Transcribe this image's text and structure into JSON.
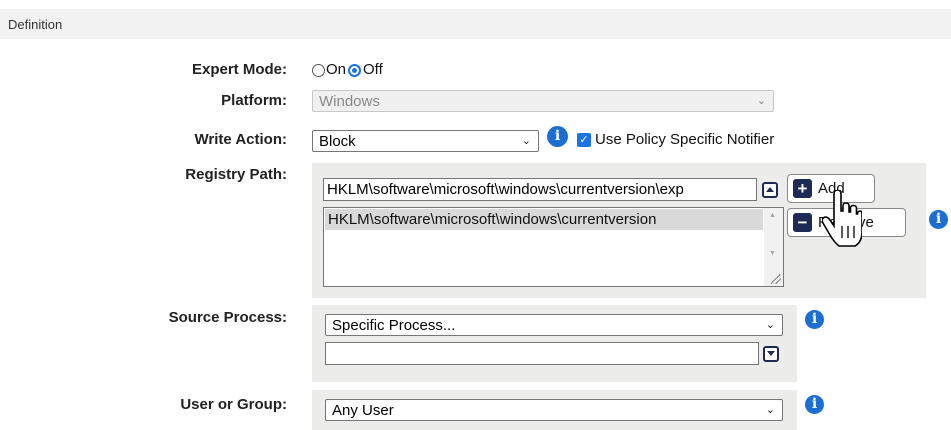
{
  "section": {
    "title": "Definition"
  },
  "expert_mode": {
    "label": "Expert Mode:",
    "options": [
      "On",
      "Off"
    ],
    "selected": "Off"
  },
  "platform": {
    "label": "Platform:",
    "value": "Windows",
    "disabled": true
  },
  "write_action": {
    "label": "Write Action:",
    "value": "Block",
    "notifier_label": "Use Policy Specific Notifier",
    "notifier_checked": true
  },
  "registry_path": {
    "label": "Registry Path:",
    "input_value": "HKLM\\software\\microsoft\\windows\\currentversion\\exp",
    "list_items": [
      "HKLM\\software\\microsoft\\windows\\currentversion"
    ],
    "add_label": "Add",
    "remove_label": "Remove"
  },
  "source_process": {
    "label": "Source Process:",
    "value": "Specific Process...",
    "input_value": ""
  },
  "user_or_group": {
    "label": "User or Group:",
    "value": "Any User"
  },
  "colors": {
    "accent": "#1a73e8",
    "info_icon": "#1c6ed3",
    "button_icon": "#1e2a56",
    "panel": "#ececea",
    "header": "#f2f2f2"
  }
}
